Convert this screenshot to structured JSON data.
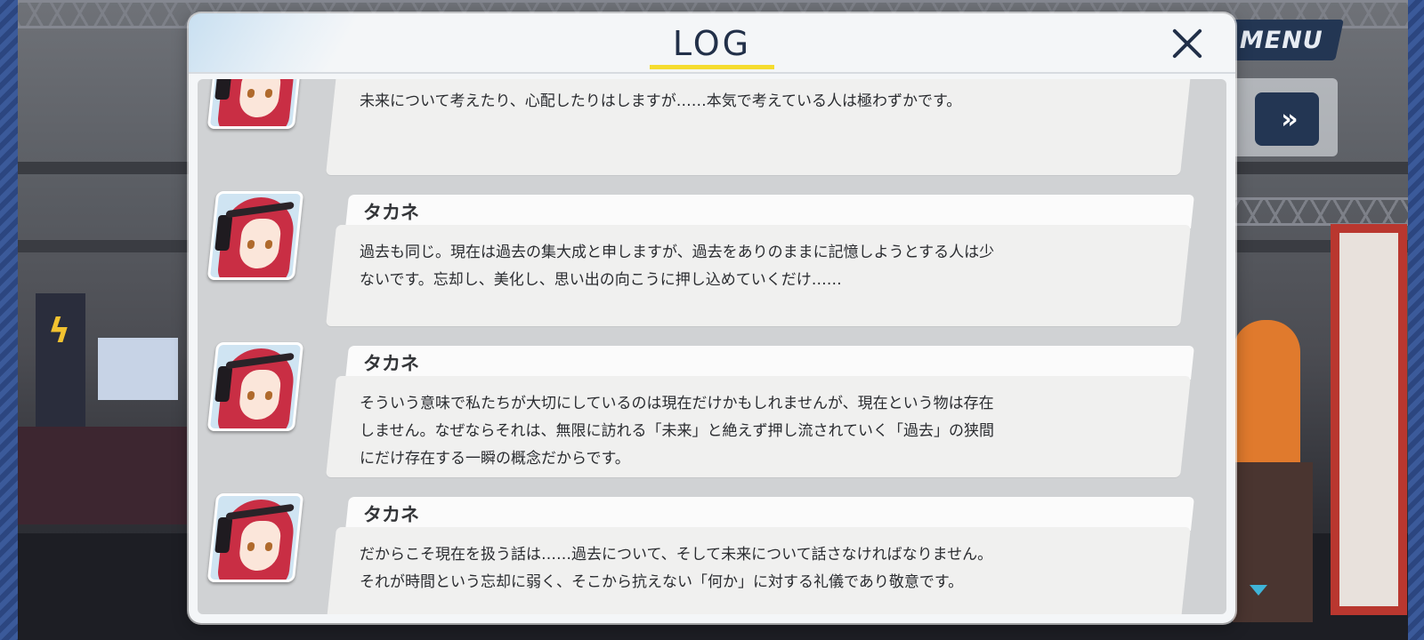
{
  "panel": {
    "title": "LOG",
    "close_icon": "close-icon"
  },
  "hud": {
    "menu_label": "MENU",
    "fast_forward_label": "»"
  },
  "entries": [
    {
      "speaker": "",
      "text": "未来について考えたり、心配したりはしますが……本気で考えている人は極わずかです。"
    },
    {
      "speaker": "タカネ",
      "text": "過去も同じ。現在は過去の集大成と申しますが、過去をありのままに記憶しようとする人は少\nないです。忘却し、美化し、思い出の向こうに押し込めていくだけ……"
    },
    {
      "speaker": "タカネ",
      "text": "そういう意味で私たちが大切にしているのは現在だけかもしれませんが、現在という物は存在\nしません。なぜならそれは、無限に訪れる「未来」と絶えず押し流されていく「過去」の狭間\nにだけ存在する一瞬の概念だからです。"
    },
    {
      "speaker": "タカネ",
      "text": "だからこそ現在を扱う話は……過去について、そして未来について話さなければなりません。\nそれが時間という忘却に弱く、そこから抗えない「何か」に対する礼儀であり敬意です。"
    }
  ],
  "colors": {
    "panel_title": "#223049",
    "accent_underline": "#f5dc2f",
    "hud_button": "#233653",
    "hair": "#c92e44"
  }
}
